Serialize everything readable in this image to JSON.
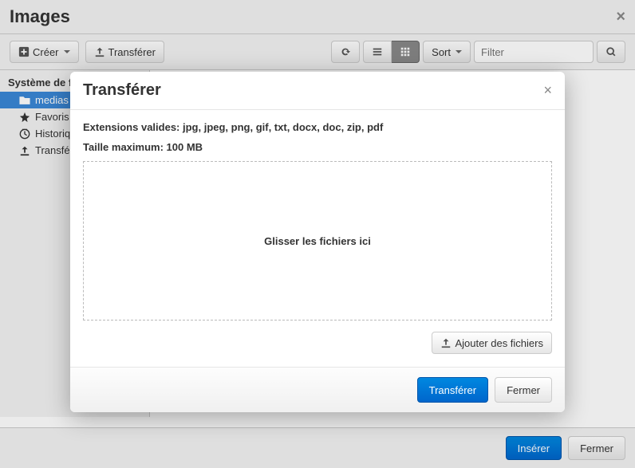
{
  "header": {
    "title": "Images"
  },
  "toolbar": {
    "create_label": "Créer",
    "transfer_label": "Transférer",
    "sort_label": "Sort",
    "filter_placeholder": "Filter"
  },
  "sidebar": {
    "title": "Système de fichiers",
    "items": [
      {
        "label": "medias",
        "icon": "folder-icon",
        "selected": true
      },
      {
        "label": "Favoris",
        "icon": "star-icon",
        "selected": false
      },
      {
        "label": "Historique",
        "icon": "clock-icon",
        "selected": false
      },
      {
        "label": "Transférer",
        "icon": "upload-icon",
        "selected": false
      }
    ]
  },
  "footer": {
    "insert_label": "Insérer",
    "close_label": "Fermer"
  },
  "modal": {
    "title": "Transférer",
    "extensions_label": "Extensions valides: jpg, jpeg, png, gif, txt, docx, doc, zip, pdf",
    "maxsize_label": "Taille maximum: 100 MB",
    "dropzone_text": "Glisser les fichiers ici",
    "add_files_label": "Ajouter des fichiers",
    "transfer_label": "Transférer",
    "close_label": "Fermer"
  }
}
